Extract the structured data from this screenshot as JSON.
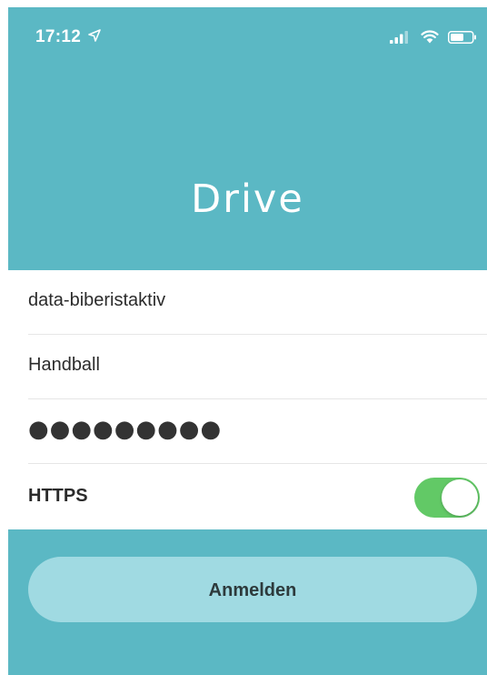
{
  "status_bar": {
    "time": "17:12",
    "icons": [
      "location-arrow-icon",
      "signal-icon",
      "wifi-icon",
      "battery-icon"
    ]
  },
  "header": {
    "title": "Drive"
  },
  "form": {
    "server": {
      "value": "data-biberistaktiv"
    },
    "username": {
      "value": "Handball"
    },
    "password": {
      "masked": "●●●●●●●●●"
    },
    "https": {
      "label": "HTTPS",
      "enabled": true
    }
  },
  "login": {
    "label": "Anmelden"
  },
  "colors": {
    "background": "#5bb8c4",
    "button": "#a0dae2",
    "toggle_on": "#62c966",
    "text": "#2b2b2b"
  }
}
